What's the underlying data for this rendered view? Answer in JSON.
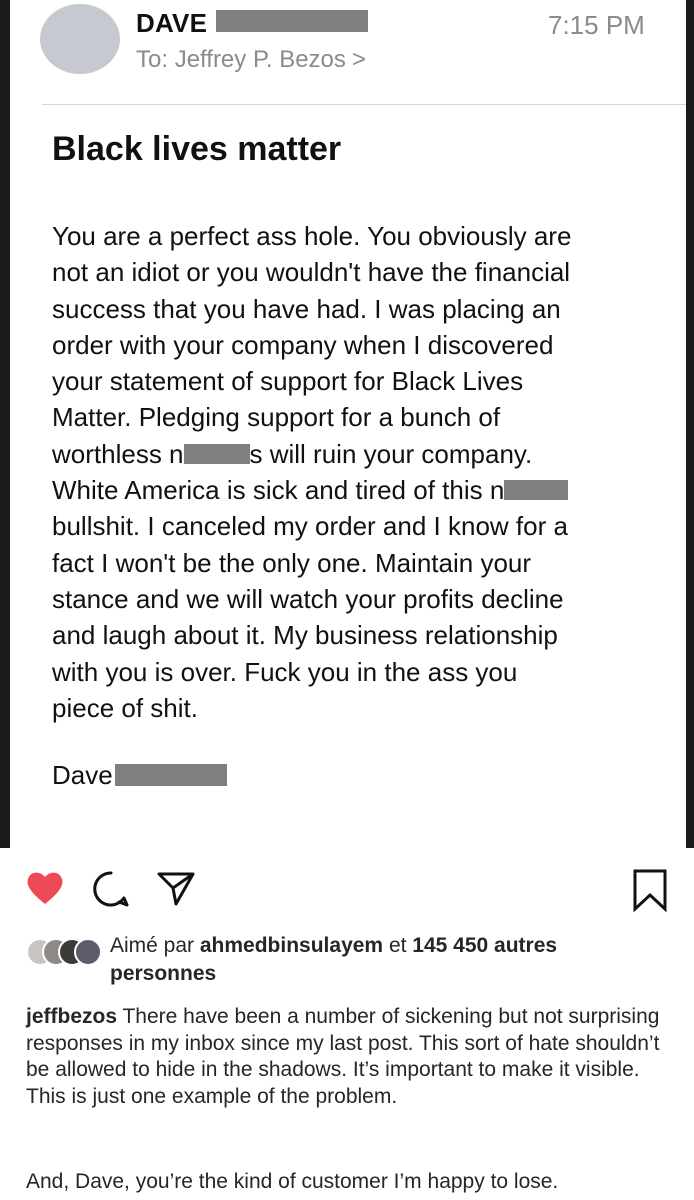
{
  "email": {
    "sender_name": "DAVE",
    "time": "7:15 PM",
    "to_label": "To:",
    "to_name": "Jeffrey P. Bezos",
    "to_chevron": ">",
    "subject": "Black lives matter",
    "body": {
      "l1": "You are a perfect ass hole. You obviously are",
      "l2": "not an idiot or you wouldn't have the financial",
      "l3": "success that you have had. I was placing an",
      "l4": "order with your company when I discovered",
      "l5": "your statement of support for Black Lives",
      "l6": "Matter. Pledging support for a bunch of",
      "l7a": "worthless n",
      "l7b": "s will ruin your company.",
      "l8a": "White America is sick and tired of this n",
      "l9": "bullshit. I canceled my order and I know for a",
      "l10": "fact I won't be the only one. Maintain your",
      "l11": "stance and we will watch your profits decline",
      "l12": "and laugh about it. My business relationship",
      "l13": "with you is over. Fuck you in the ass you",
      "l14": "piece of shit."
    },
    "signature": "Dave"
  },
  "instagram": {
    "liked_prefix": "Aimé par ",
    "liked_user": "ahmedbinsulayem",
    "liked_mid": " et ",
    "liked_count": "145 450 autres",
    "liked_suffix": "personnes",
    "caption_user": "jeffbezos",
    "caption_text": " There have been a number of sickening but not surprising responses in my inbox since my last post. This sort of hate shouldn’t be allowed to hide in the shadows. It’s important to make it visible. This is just one example of the problem.",
    "caption_text2": "And, Dave, you’re the kind of customer I’m happy to lose.",
    "colors": {
      "heart": "#ed4956",
      "text": "#262626",
      "redaction": "#7f7f7f",
      "meta_gray": "#8a8a8f"
    },
    "icons": [
      "heart-icon",
      "comment-icon",
      "share-icon",
      "bookmark-icon"
    ]
  }
}
